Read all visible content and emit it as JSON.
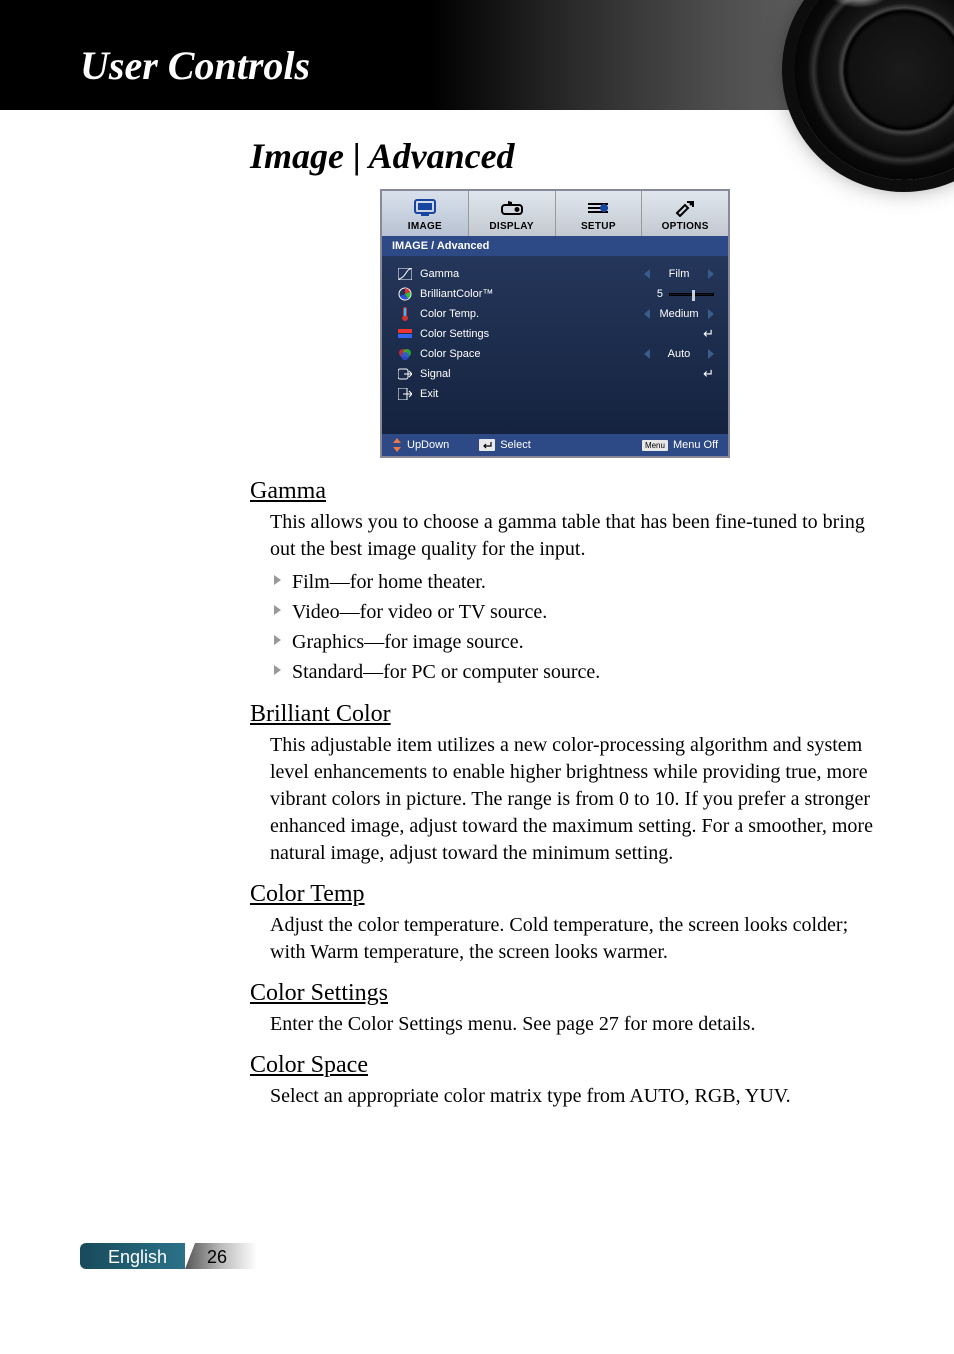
{
  "header": {
    "title": "User Controls"
  },
  "section": {
    "title": "Image | Advanced"
  },
  "osd": {
    "tabs": [
      {
        "label": "IMAGE",
        "icon": "monitor-icon",
        "active": true
      },
      {
        "label": "DISPLAY",
        "icon": "projector-icon",
        "active": false
      },
      {
        "label": "SETUP",
        "icon": "sliders-icon",
        "active": false
      },
      {
        "label": "OPTIONS",
        "icon": "tools-icon",
        "active": false
      }
    ],
    "breadcrumb": "IMAGE / Advanced",
    "rows": [
      {
        "label": "Gamma",
        "valueType": "select",
        "value": "Film"
      },
      {
        "label": "BrilliantColor™",
        "valueType": "slider",
        "value": "5"
      },
      {
        "label": "Color Temp.",
        "valueType": "select",
        "value": "Medium"
      },
      {
        "label": "Color Settings",
        "valueType": "enter"
      },
      {
        "label": "Color Space",
        "valueType": "select",
        "value": "Auto"
      },
      {
        "label": "Signal",
        "valueType": "enter"
      },
      {
        "label": "Exit",
        "valueType": "none"
      }
    ],
    "footer": {
      "updown": "UpDown",
      "select": "Select",
      "menuoff": "Menu Off"
    }
  },
  "descriptions": {
    "gamma": {
      "heading": "Gamma",
      "text": "This allows you to choose a gamma table that has been fine-tuned to bring out the best image quality for the input.",
      "items": [
        "Film—for home theater.",
        "Video—for video or TV source.",
        "Graphics—for image source.",
        "Standard—for PC or computer source."
      ]
    },
    "brilliant": {
      "heading": "Brilliant Color",
      "text": "This adjustable item utilizes a new color-processing algorithm and system level enhancements to enable higher brightness while providing true, more vibrant colors in picture. The range is from 0 to 10. If you prefer a stronger enhanced image, adjust toward the maximum setting. For a smoother, more natural image, adjust toward the minimum setting."
    },
    "colortemp": {
      "heading": "Color Temp",
      "text": "Adjust the color temperature. Cold temperature, the screen looks colder; with Warm temperature, the screen looks warmer."
    },
    "colorsettings": {
      "heading": "Color Settings",
      "text": "Enter the Color Settings menu. See page 27 for more details."
    },
    "colorspace": {
      "heading": "Color Space",
      "text": "Select an appropriate color matrix type from AUTO, RGB, YUV."
    }
  },
  "footer": {
    "language": "English",
    "page": "26"
  }
}
